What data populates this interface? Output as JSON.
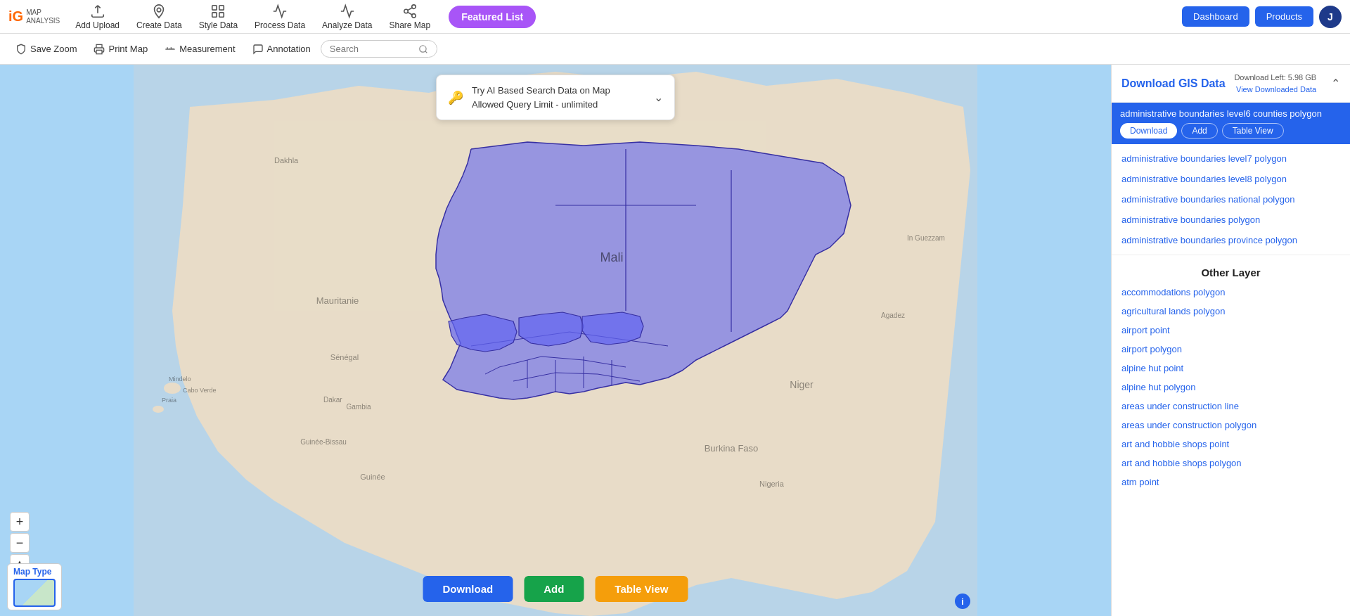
{
  "navbar": {
    "logo": "iG",
    "logo_subtitle": "MAP\nANALYSIS",
    "nav_items": [
      {
        "id": "add-upload",
        "label": "Add Upload",
        "icon": "upload"
      },
      {
        "id": "create-data",
        "label": "Create Data",
        "icon": "pin"
      },
      {
        "id": "style-data",
        "label": "Style Data",
        "icon": "style"
      },
      {
        "id": "process-data",
        "label": "Process Data",
        "icon": "process"
      },
      {
        "id": "analyze-data",
        "label": "Analyze Data",
        "icon": "analyze"
      },
      {
        "id": "share-map",
        "label": "Share Map",
        "icon": "share"
      }
    ],
    "featured_list": "Featured List",
    "dashboard": "Dashboard",
    "products": "Products",
    "user_initial": "J"
  },
  "toolbar": {
    "save_zoom": "Save Zoom",
    "print_map": "Print Map",
    "measurement": "Measurement",
    "annotation": "Annotation",
    "search_placeholder": "Search"
  },
  "ai_banner": {
    "text_line1": "Try AI Based Search Data on Map",
    "text_line2": "Allowed Query Limit - unlimited",
    "key_icon": "🔑"
  },
  "map_actions": {
    "download": "Download",
    "add": "Add",
    "table_view": "Table View"
  },
  "map_controls": {
    "zoom_in": "+",
    "zoom_out": "−",
    "reset": "▲"
  },
  "map_type": {
    "label": "Map Type"
  },
  "right_panel": {
    "title": "Download GIS Data",
    "meta_line1": "Download Left: 5.98 GB",
    "meta_line2": "View Downloaded Data",
    "selected_layer": "administrative boundaries level6 counties polygon",
    "layer_download": "Download",
    "layer_add": "Add",
    "layer_table": "Table View",
    "layers": [
      "administrative boundaries level7 polygon",
      "administrative boundaries level8 polygon",
      "administrative boundaries national polygon",
      "administrative boundaries polygon",
      "administrative boundaries province polygon"
    ],
    "other_layer_title": "Other Layer",
    "other_layers": [
      "accommodations polygon",
      "agricultural lands polygon",
      "airport point",
      "airport polygon",
      "alpine hut point",
      "alpine hut polygon",
      "areas under construction line",
      "areas under construction polygon",
      "art and hobbie shops point",
      "art and hobbie shops polygon",
      "atm point"
    ]
  }
}
